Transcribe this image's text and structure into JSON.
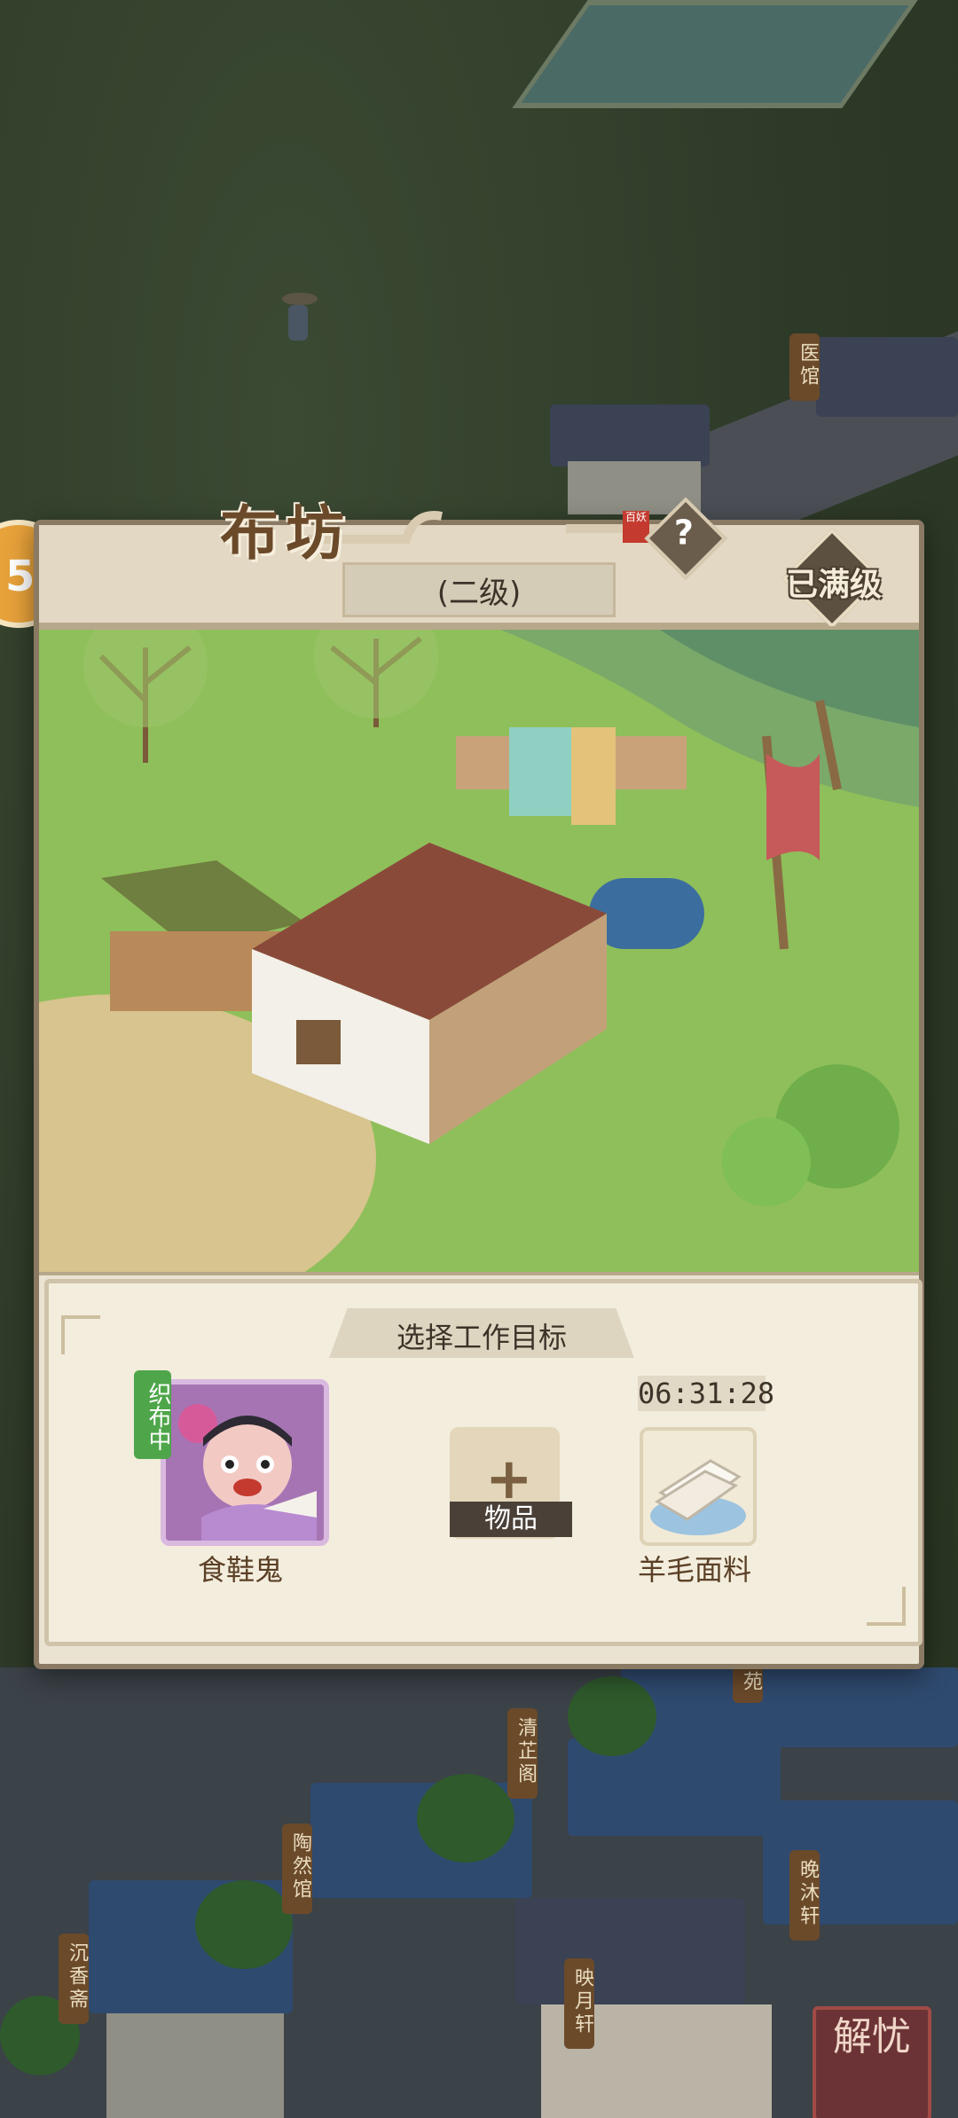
{
  "building": {
    "name": "布坊",
    "stamp": "百妖",
    "level": "(二级)",
    "max_level_label": "已满级",
    "help_icon": "question-icon"
  },
  "work": {
    "section_title": "选择工作目标",
    "worker": {
      "name": "食鞋鬼",
      "status": "织布中"
    },
    "item_slot": {
      "label": "物品",
      "icon": "plus-icon"
    },
    "product": {
      "name": "羊毛面料",
      "timer": "06:31:28"
    }
  },
  "map_labels": {
    "top_right": "医馆",
    "mid_right": "苑",
    "qingzhi": "清芷阁",
    "taoran": "陶然馆",
    "chenxiang": "沉香斋",
    "yingyue": "映月轩",
    "wanmu": "晚沐轩"
  },
  "seal": {
    "text": "解忧"
  },
  "left_badge": {
    "glyph": "5"
  },
  "colors": {
    "panel_bg": "#ebe3d2",
    "frame": "#8a7a63",
    "title_brown": "#6b4a2a",
    "status_green": "#4fa64a",
    "worker_purple": "#9a63a8",
    "stamp_red": "#c43a2e"
  }
}
